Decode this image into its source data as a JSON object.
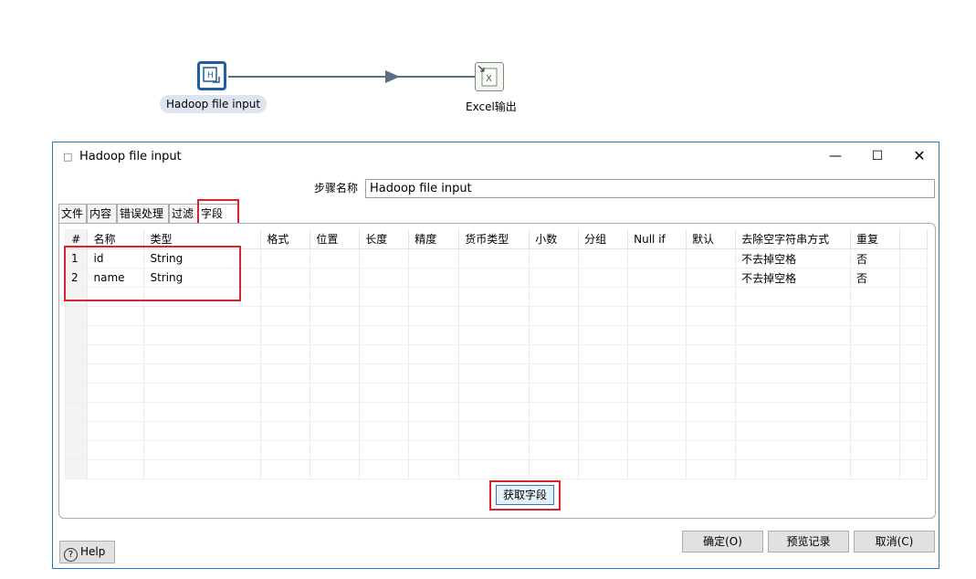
{
  "canvas": {
    "source_node": {
      "label": "Hadoop file input",
      "icon": "hadoop-file-input-icon"
    },
    "target_node": {
      "label": "Excel输出",
      "icon": "excel-output-icon"
    }
  },
  "dialog": {
    "title": "Hadoop file input",
    "step_name_label": "步骤名称",
    "step_name_value": "Hadoop file input",
    "tabs": [
      {
        "label": "文件"
      },
      {
        "label": "内容"
      },
      {
        "label": "错误处理"
      },
      {
        "label": "过滤"
      },
      {
        "label": "字段"
      }
    ],
    "active_tab": "字段",
    "table": {
      "headers": [
        "#",
        "名称",
        "类型",
        "格式",
        "位置",
        "长度",
        "精度",
        "货币类型",
        "小数",
        "分组",
        "Null if",
        "默认",
        "去除空字符串方式",
        "重复"
      ],
      "rows": [
        [
          "1",
          "id",
          "String",
          "",
          "",
          "",
          "",
          "",
          "",
          "",
          "",
          "",
          "不去掉空格",
          "否"
        ],
        [
          "2",
          "name",
          "String",
          "",
          "",
          "",
          "",
          "",
          "",
          "",
          "",
          "",
          "不去掉空格",
          "否"
        ]
      ]
    },
    "get_fields_button": "获取字段",
    "ok_button": "确定(O)",
    "preview_button": "预览记录",
    "cancel_button": "取消(C)",
    "help_button": "Help",
    "highlight_color": "#d9232d",
    "accent_color": "#2b79c2"
  }
}
